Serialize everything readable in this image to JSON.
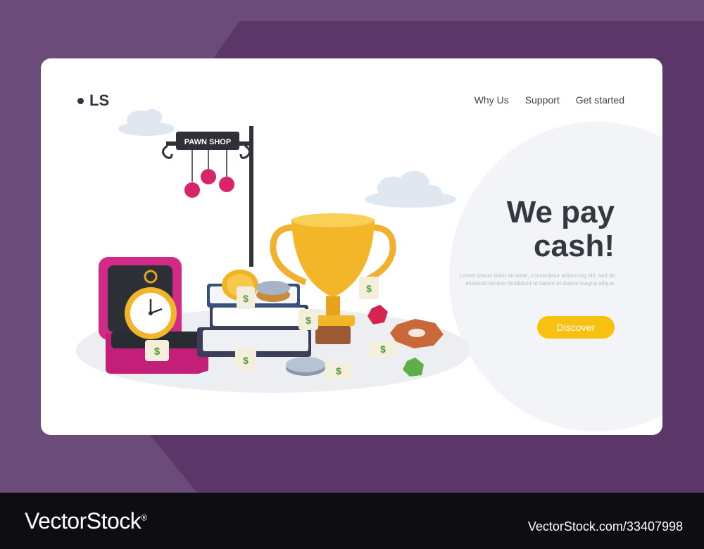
{
  "logo": {
    "text": "LS"
  },
  "nav": {
    "items": [
      "Why Us",
      "Support",
      "Get started"
    ]
  },
  "hero": {
    "headline_line1": "We pay",
    "headline_line2": "cash!",
    "lorem": "Lorem ipsum dolor sit amet, consectetur adipiscing elit, sed do eiusmod tempor incididunt ut labore et dolore magna aliqua.",
    "cta_label": "Discover"
  },
  "illustration": {
    "sign_text": "PAWN SHOP",
    "tag_symbol": "$"
  },
  "footer": {
    "brand": "VectorStock",
    "brand_mark": "®",
    "asset_id": "VectorStock.com/33407998"
  },
  "colors": {
    "background": "#6b4b79",
    "card": "#ffffff",
    "accent": "#f8c111",
    "text_dark": "#34393f",
    "footer": "#0d0d12"
  }
}
